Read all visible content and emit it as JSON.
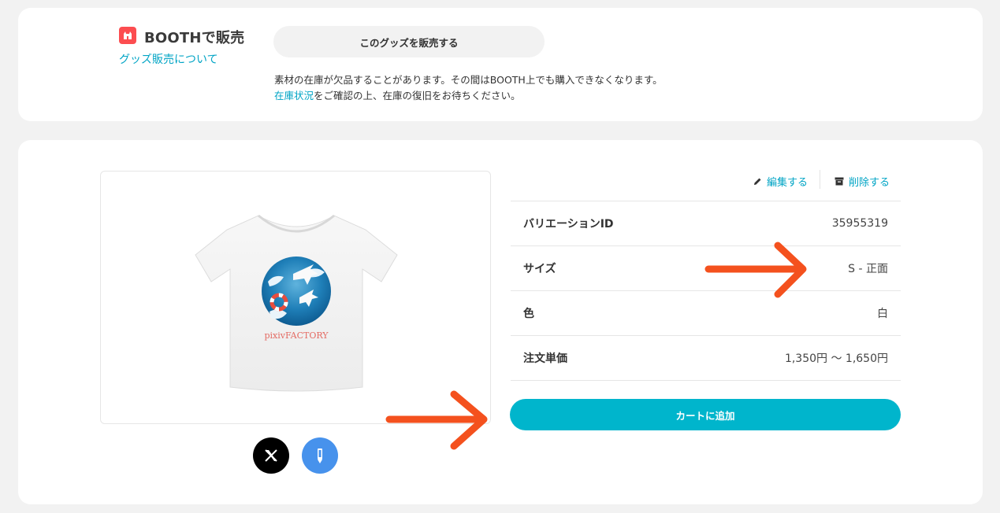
{
  "booth": {
    "title": "BOOTHで販売",
    "about_link": "グッズ販売について",
    "sell_button": "このグッズを販売する",
    "stock_note_line1": "素材の在庫が欠品することがあります。その間はBOOTH上でも購入できなくなります。",
    "stock_link": "在庫状況",
    "stock_note_line2_rest": "をご確認の上、在庫の復旧をお待ちください。",
    "brand_color": "#fc4d50"
  },
  "product": {
    "image_icon": "tshirt-product-image",
    "print_text": "pixivFACTORY",
    "share": {
      "x_icon": "x-logo-icon",
      "pixiv_icon": "pencil-icon"
    }
  },
  "actions": {
    "edit_label": "編集する",
    "delete_label": "削除する"
  },
  "details": [
    {
      "label": "バリエーションID",
      "value": "35955319"
    },
    {
      "label": "サイズ",
      "value": "S - 正面"
    },
    {
      "label": "色",
      "value": "白"
    },
    {
      "label": "注文単価",
      "value": "1,350円 〜 1,650円"
    }
  ],
  "cart": {
    "label": "カートに追加",
    "color": "#00b5cc"
  },
  "annotations": {
    "arrow_color": "#f4511e"
  }
}
